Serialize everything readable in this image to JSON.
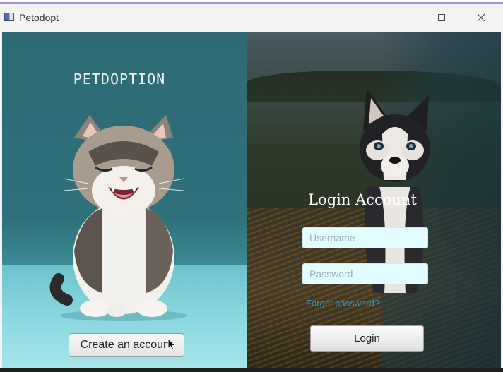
{
  "window": {
    "title": "Petodopt",
    "icon": "app-window-icon",
    "controls": [
      "minimize-icon",
      "maximize-icon",
      "close-icon"
    ]
  },
  "left_panel": {
    "brand": "PETDOPTION",
    "image": "kitten-photo",
    "create_button": "Create an account"
  },
  "right_panel": {
    "image": "husky-photo",
    "title": "Login Account",
    "username_placeholder": "Username",
    "password_placeholder": "Password",
    "forgot_link": "Forget password?",
    "login_button": "Login"
  },
  "colors": {
    "input_bg": "#e1fdff",
    "link": "#1e9bd7",
    "left_bg": "#2f707a"
  }
}
